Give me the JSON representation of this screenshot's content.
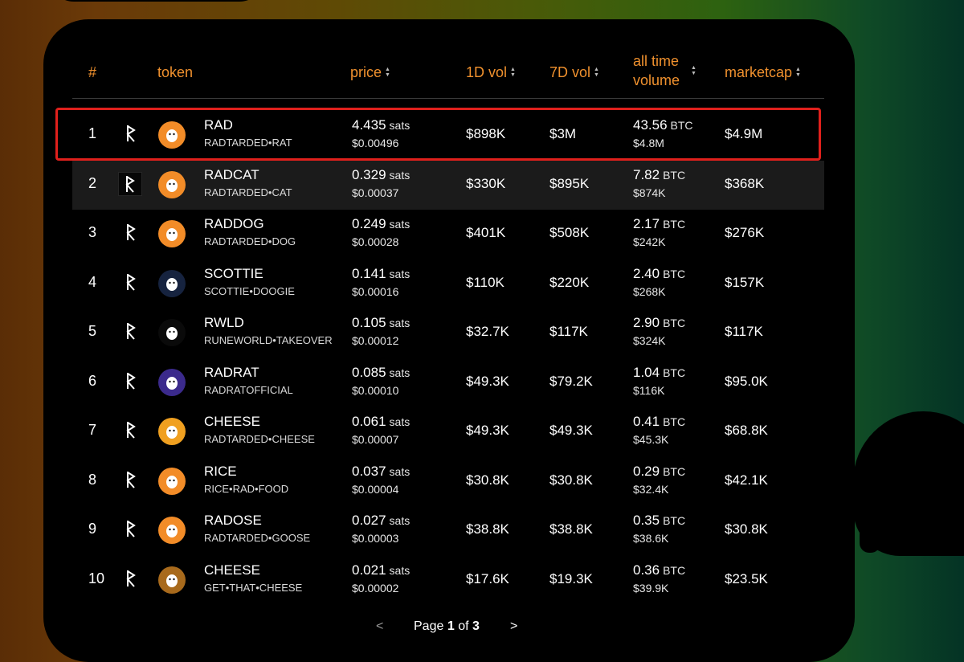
{
  "colors": {
    "header_accent": "#f0912e",
    "highlight_border": "#e0201c",
    "row_alt_bg": "#1b1b1b",
    "panel_bg": "#000000"
  },
  "table": {
    "headers": {
      "rank": "#",
      "token": "token",
      "price": "price",
      "vol_1d": "1D vol",
      "vol_7d": "7D vol",
      "all_time_volume": "all time volume",
      "marketcap": "marketcap"
    },
    "price_unit": "sats",
    "volume_unit": "BTC",
    "rows": [
      {
        "rank": "1",
        "name": "RAD",
        "rune": "RADTARDED•RAT",
        "price_sats": "4.435",
        "price_usd": "$0.00496",
        "vol_1d": "$898K",
        "vol_7d": "$3M",
        "atv_btc": "43.56",
        "atv_usd": "$4.8M",
        "marketcap": "$4.9M",
        "avatar_icon": "rat-avatar-icon",
        "avatar_color": "#f28c28"
      },
      {
        "rank": "2",
        "name": "RADCAT",
        "rune": "RADTARDED•CAT",
        "price_sats": "0.329",
        "price_usd": "$0.00037",
        "vol_1d": "$330K",
        "vol_7d": "$895K",
        "atv_btc": "7.82",
        "atv_usd": "$874K",
        "marketcap": "$368K",
        "avatar_icon": "cat-avatar-icon",
        "avatar_color": "#f28c28"
      },
      {
        "rank": "3",
        "name": "RADDOG",
        "rune": "RADTARDED•DOG",
        "price_sats": "0.249",
        "price_usd": "$0.00028",
        "vol_1d": "$401K",
        "vol_7d": "$508K",
        "atv_btc": "2.17",
        "atv_usd": "$242K",
        "marketcap": "$276K",
        "avatar_icon": "dog-avatar-icon",
        "avatar_color": "#f28c28"
      },
      {
        "rank": "4",
        "name": "SCOTTIE",
        "rune": "SCOTTIE•DOOGIE",
        "price_sats": "0.141",
        "price_usd": "$0.00016",
        "vol_1d": "$110K",
        "vol_7d": "$220K",
        "atv_btc": "2.40",
        "atv_usd": "$268K",
        "marketcap": "$157K",
        "avatar_icon": "scottie-avatar-icon",
        "avatar_color": "#16233f"
      },
      {
        "rank": "5",
        "name": "RWLD",
        "rune": "RUNEWORLD•TAKEOVER",
        "price_sats": "0.105",
        "price_usd": "$0.00012",
        "vol_1d": "$32.7K",
        "vol_7d": "$117K",
        "atv_btc": "2.90",
        "atv_usd": "$324K",
        "marketcap": "$117K",
        "avatar_icon": "runeworld-avatar-icon",
        "avatar_color": "#0a0a0a"
      },
      {
        "rank": "6",
        "name": "RADRAT",
        "rune": "RADRATOFFICIAL",
        "price_sats": "0.085",
        "price_usd": "$0.00010",
        "vol_1d": "$49.3K",
        "vol_7d": "$79.2K",
        "atv_btc": "1.04",
        "atv_usd": "$116K",
        "marketcap": "$95.0K",
        "avatar_icon": "radrat-avatar-icon",
        "avatar_color": "#3b2a8c"
      },
      {
        "rank": "7",
        "name": "CHEESE",
        "rune": "RADTARDED•CHEESE",
        "price_sats": "0.061",
        "price_usd": "$0.00007",
        "vol_1d": "$49.3K",
        "vol_7d": "$49.3K",
        "atv_btc": "0.41",
        "atv_usd": "$45.3K",
        "marketcap": "$68.8K",
        "avatar_icon": "cheese-avatar-icon",
        "avatar_color": "#f0a020"
      },
      {
        "rank": "8",
        "name": "RICE",
        "rune": "RICE•RAD•FOOD",
        "price_sats": "0.037",
        "price_usd": "$0.00004",
        "vol_1d": "$30.8K",
        "vol_7d": "$30.8K",
        "atv_btc": "0.29",
        "atv_usd": "$32.4K",
        "marketcap": "$42.1K",
        "avatar_icon": "rice-avatar-icon",
        "avatar_color": "#f28c28"
      },
      {
        "rank": "9",
        "name": "RADOSE",
        "rune": "RADTARDED•GOOSE",
        "price_sats": "0.027",
        "price_usd": "$0.00003",
        "vol_1d": "$38.8K",
        "vol_7d": "$38.8K",
        "atv_btc": "0.35",
        "atv_usd": "$38.6K",
        "marketcap": "$30.8K",
        "avatar_icon": "goose-avatar-icon",
        "avatar_color": "#f28c28"
      },
      {
        "rank": "10",
        "name": "CHEESE",
        "rune": "GET•THAT•CHEESE",
        "price_sats": "0.021",
        "price_usd": "$0.00002",
        "vol_1d": "$17.6K",
        "vol_7d": "$19.3K",
        "atv_btc": "0.36",
        "atv_usd": "$39.9K",
        "marketcap": "$23.5K",
        "avatar_icon": "coin-avatar-icon",
        "avatar_color": "#a86a1c"
      }
    ]
  },
  "pagination": {
    "prev": "<",
    "next": ">",
    "page_word": "Page",
    "current": "1",
    "of_word": "of",
    "total": "3"
  }
}
